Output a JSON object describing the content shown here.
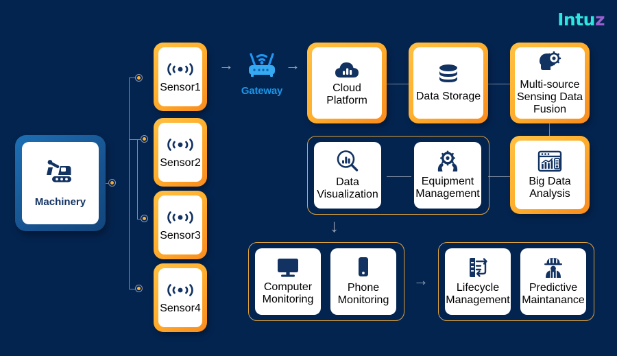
{
  "brand": {
    "name": "Intuz",
    "name_main": "Intu",
    "name_accent": "z",
    "color": "#2ee6e0",
    "accent_color": "#9b5fd0"
  },
  "theme": {
    "background": "#042450",
    "orange": "#ffb02e",
    "orange_deep": "#f98b1d",
    "blue_frame": "#17528f",
    "text_navy": "#123262",
    "line": "#7d8aa0",
    "group_outline": "#e0a23c",
    "gateway_blue": "#1b96e8"
  },
  "source": {
    "label": "Machinery",
    "icon": "excavator-icon"
  },
  "sensors": [
    {
      "label": "Sensor1",
      "icon": "signal-wave-icon"
    },
    {
      "label": "Sensor2",
      "icon": "signal-wave-icon"
    },
    {
      "label": "Sensor3",
      "icon": "signal-wave-icon"
    },
    {
      "label": "Sensor4",
      "icon": "signal-wave-icon"
    }
  ],
  "gateway": {
    "label": "Gateway",
    "icon": "router-icon"
  },
  "arrows": {
    "sensor_to_gateway": "→",
    "gateway_to_cloud": "→",
    "cloud_to_visualization": "↓",
    "monitoring_to_management": "→"
  },
  "cloud_row": [
    {
      "label": "Cloud Platform",
      "icon": "cloud-chart-icon"
    },
    {
      "label": "Data Storage",
      "icon": "database-icon"
    },
    {
      "label": "Multi-source Sensing Data Fusion",
      "line1": "Multi-source",
      "line2": "Sensing Data",
      "line3": "Fusion",
      "icon": "head-gear-icon"
    }
  ],
  "analysis_row": {
    "group": [
      {
        "label": "Data Visualization",
        "line1": "Data",
        "line2": "Visualization",
        "icon": "chart-magnifier-icon"
      },
      {
        "label": "Equipment Management",
        "line1": "Equipment",
        "line2": "Management",
        "icon": "gear-hands-icon"
      }
    ],
    "standalone": {
      "label": "Big Data Analysis",
      "line1": "Big Data",
      "line2": "Analysis",
      "icon": "dashboard-analytics-icon"
    }
  },
  "monitoring_group": [
    {
      "label": "Computer Monitoring",
      "line1": "Computer",
      "line2": "Monitoring",
      "icon": "monitor-icon"
    },
    {
      "label": "Phone Monitoring",
      "line1": "Phone",
      "line2": "Monitoring",
      "icon": "smartphone-icon"
    }
  ],
  "management_group": [
    {
      "label": "Lifecycle Management",
      "line1": "Lifecycle",
      "line2": "Management",
      "icon": "lifecycle-document-icon"
    },
    {
      "label": "Predictive Maintanance",
      "line1": "Predictive",
      "line2": "Maintanance",
      "icon": "worker-helmet-icon"
    }
  ]
}
